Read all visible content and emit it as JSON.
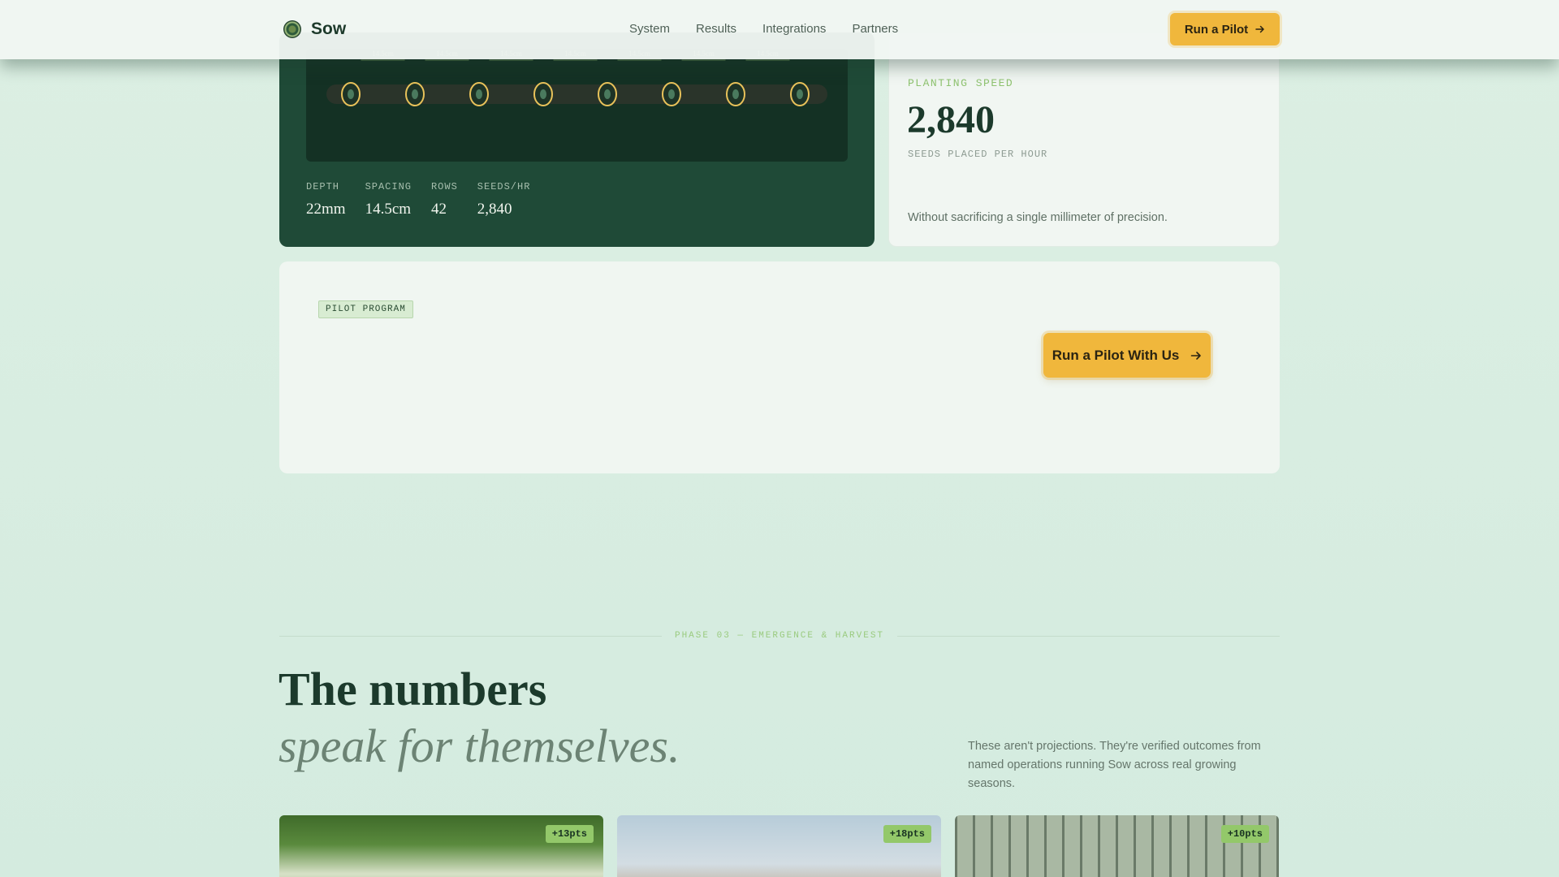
{
  "nav": {
    "brand": "Sow",
    "links": [
      "System",
      "Results",
      "Integrations",
      "Partners"
    ],
    "cta_label": "Run a Pilot"
  },
  "machine": {
    "spacing_marks": [
      "14.5cm",
      "14.5cm",
      "14.5cm",
      "14.5cm",
      "14.5cm",
      "14.5cm",
      "14.5cm"
    ],
    "seed_count": 8,
    "stats": [
      {
        "label": "DEPTH",
        "value": "22mm"
      },
      {
        "label": "SPACING",
        "value": "14.5cm"
      },
      {
        "label": "ROWS",
        "value": "42"
      },
      {
        "label": "SEEDS/HR",
        "value": "2,840"
      }
    ]
  },
  "speed": {
    "label": "PLANTING SPEED",
    "value": "2,840",
    "sub": "SEEDS PLACED PER HOUR",
    "note": "Without sacrificing a single millimeter of precision."
  },
  "pilot": {
    "badge": "PILOT PROGRAM",
    "cta_label": "Run a Pilot With Us"
  },
  "numbers": {
    "phase_label": "PHASE 03 — EMERGENCE & HARVEST",
    "headline_1": "The numbers",
    "headline_2": "speak for themselves.",
    "intro": "These aren't projections. They're verified outcomes from named operations running Sow across real growing seasons.",
    "cards": [
      {
        "badge": "+13pts"
      },
      {
        "badge": "+18pts"
      },
      {
        "badge": "+10pts"
      }
    ]
  },
  "colors": {
    "accent": "#f0b73c",
    "dark_green": "#1f4a37",
    "highlight_green": "#8fc370"
  },
  "icons": {
    "arrow": "arrow-right-icon",
    "logo": "sow-logo-icon"
  }
}
